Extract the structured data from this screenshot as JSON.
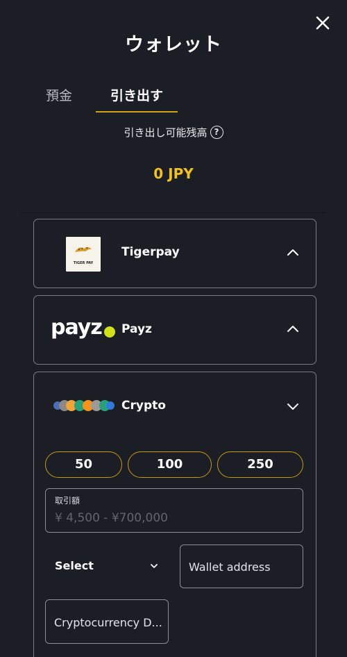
{
  "header": {
    "title": "ウォレット",
    "close_icon": "close-icon"
  },
  "tabs": [
    {
      "label": "預金",
      "active": false
    },
    {
      "label": "引き出す",
      "active": true
    }
  ],
  "balance": {
    "label": "引き出し可能残高",
    "help_icon": "help-icon",
    "help_glyph": "?",
    "value": "0 JPY",
    "color": "#f2c21b"
  },
  "methods": [
    {
      "name": "Tigerpay",
      "logo": "tigerpay-logo",
      "logo_text": "TIGER PAY",
      "expanded": false
    },
    {
      "name": "Payz",
      "logo": "payz-logo",
      "logo_text": "payz",
      "expanded": false
    },
    {
      "name": "Crypto",
      "logo": "crypto-coins-logo",
      "expanded": true
    }
  ],
  "crypto_form": {
    "quick_amounts": [
      "50",
      "100",
      "250"
    ],
    "amount_field": {
      "label": "取引額",
      "placeholder": "¥ 4,500 - ¥700,000"
    },
    "currency_select": {
      "value": "Select"
    },
    "wallet_address": {
      "placeholder": "Wallet address"
    },
    "destination": {
      "placeholder": "Cryptocurrency D..."
    }
  },
  "colors": {
    "background": "#1c1e26",
    "accent": "#d4a21a",
    "border": "#7a7d86",
    "payz_dot": "#cfe31a"
  }
}
